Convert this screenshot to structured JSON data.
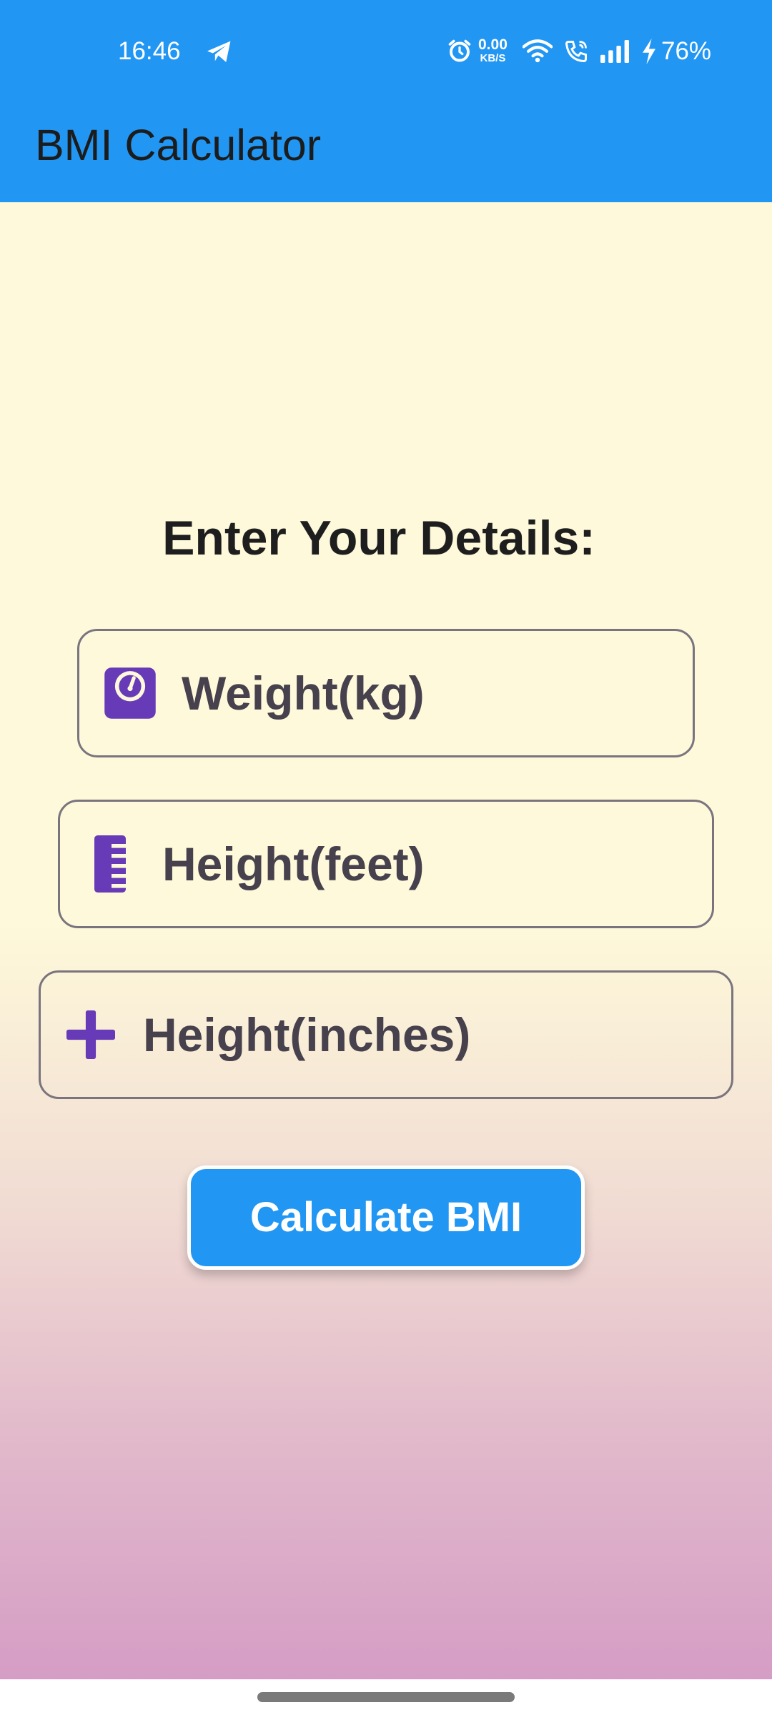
{
  "status_bar": {
    "time": "16:46",
    "net_speed_value": "0.00",
    "net_speed_unit": "KB/S",
    "battery": "76%",
    "icons": [
      "telegram-icon",
      "alarm-icon",
      "wifi-icon",
      "call-icon",
      "signal-icon",
      "bolt-icon"
    ]
  },
  "app_bar": {
    "title": "BMI Calculator",
    "color": "#2196F3"
  },
  "form": {
    "heading": "Enter Your Details:",
    "weight": {
      "placeholder": "Weight(kg)",
      "value": "",
      "icon": "scale-icon"
    },
    "height_feet": {
      "placeholder": "Height(feet)",
      "value": "",
      "icon": "ruler-icon"
    },
    "height_inches": {
      "placeholder": "Height(inches)",
      "value": "",
      "icon": "plus-icon"
    },
    "icon_color": "#673AB7"
  },
  "actions": {
    "calculate_label": "Calculate BMI"
  }
}
